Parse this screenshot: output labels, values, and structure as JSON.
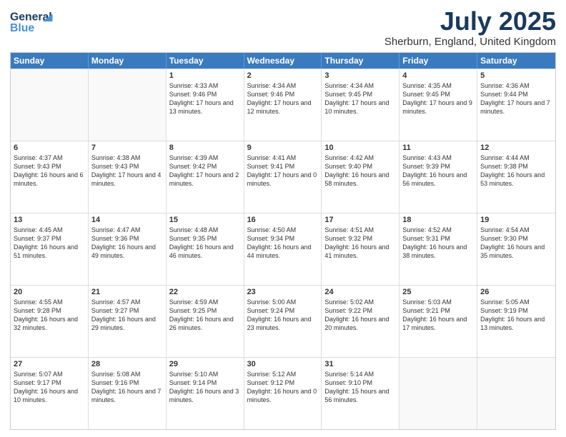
{
  "logo": {
    "line1": "General",
    "line2": "Blue"
  },
  "header": {
    "month": "July 2025",
    "location": "Sherburn, England, United Kingdom"
  },
  "days_of_week": [
    "Sunday",
    "Monday",
    "Tuesday",
    "Wednesday",
    "Thursday",
    "Friday",
    "Saturday"
  ],
  "weeks": [
    [
      {
        "day": "",
        "empty": true
      },
      {
        "day": "",
        "empty": true
      },
      {
        "day": "1",
        "sunrise": "4:33 AM",
        "sunset": "9:46 PM",
        "daylight": "17 hours and 13 minutes."
      },
      {
        "day": "2",
        "sunrise": "4:34 AM",
        "sunset": "9:46 PM",
        "daylight": "17 hours and 12 minutes."
      },
      {
        "day": "3",
        "sunrise": "4:34 AM",
        "sunset": "9:45 PM",
        "daylight": "17 hours and 10 minutes."
      },
      {
        "day": "4",
        "sunrise": "4:35 AM",
        "sunset": "9:45 PM",
        "daylight": "17 hours and 9 minutes."
      },
      {
        "day": "5",
        "sunrise": "4:36 AM",
        "sunset": "9:44 PM",
        "daylight": "17 hours and 7 minutes."
      }
    ],
    [
      {
        "day": "6",
        "sunrise": "4:37 AM",
        "sunset": "9:43 PM",
        "daylight": "16 hours and 6 minutes."
      },
      {
        "day": "7",
        "sunrise": "4:38 AM",
        "sunset": "9:43 PM",
        "daylight": "17 hours and 4 minutes."
      },
      {
        "day": "8",
        "sunrise": "4:39 AM",
        "sunset": "9:42 PM",
        "daylight": "17 hours and 2 minutes."
      },
      {
        "day": "9",
        "sunrise": "4:41 AM",
        "sunset": "9:41 PM",
        "daylight": "17 hours and 0 minutes."
      },
      {
        "day": "10",
        "sunrise": "4:42 AM",
        "sunset": "9:40 PM",
        "daylight": "16 hours and 58 minutes."
      },
      {
        "day": "11",
        "sunrise": "4:43 AM",
        "sunset": "9:39 PM",
        "daylight": "16 hours and 56 minutes."
      },
      {
        "day": "12",
        "sunrise": "4:44 AM",
        "sunset": "9:38 PM",
        "daylight": "16 hours and 53 minutes."
      }
    ],
    [
      {
        "day": "13",
        "sunrise": "4:45 AM",
        "sunset": "9:37 PM",
        "daylight": "16 hours and 51 minutes."
      },
      {
        "day": "14",
        "sunrise": "4:47 AM",
        "sunset": "9:36 PM",
        "daylight": "16 hours and 49 minutes."
      },
      {
        "day": "15",
        "sunrise": "4:48 AM",
        "sunset": "9:35 PM",
        "daylight": "16 hours and 46 minutes."
      },
      {
        "day": "16",
        "sunrise": "4:50 AM",
        "sunset": "9:34 PM",
        "daylight": "16 hours and 44 minutes."
      },
      {
        "day": "17",
        "sunrise": "4:51 AM",
        "sunset": "9:32 PM",
        "daylight": "16 hours and 41 minutes."
      },
      {
        "day": "18",
        "sunrise": "4:52 AM",
        "sunset": "9:31 PM",
        "daylight": "16 hours and 38 minutes."
      },
      {
        "day": "19",
        "sunrise": "4:54 AM",
        "sunset": "9:30 PM",
        "daylight": "16 hours and 35 minutes."
      }
    ],
    [
      {
        "day": "20",
        "sunrise": "4:55 AM",
        "sunset": "9:28 PM",
        "daylight": "16 hours and 32 minutes."
      },
      {
        "day": "21",
        "sunrise": "4:57 AM",
        "sunset": "9:27 PM",
        "daylight": "16 hours and 29 minutes."
      },
      {
        "day": "22",
        "sunrise": "4:59 AM",
        "sunset": "9:25 PM",
        "daylight": "16 hours and 26 minutes."
      },
      {
        "day": "23",
        "sunrise": "5:00 AM",
        "sunset": "9:24 PM",
        "daylight": "16 hours and 23 minutes."
      },
      {
        "day": "24",
        "sunrise": "5:02 AM",
        "sunset": "9:22 PM",
        "daylight": "16 hours and 20 minutes."
      },
      {
        "day": "25",
        "sunrise": "5:03 AM",
        "sunset": "9:21 PM",
        "daylight": "16 hours and 17 minutes."
      },
      {
        "day": "26",
        "sunrise": "5:05 AM",
        "sunset": "9:19 PM",
        "daylight": "16 hours and 13 minutes."
      }
    ],
    [
      {
        "day": "27",
        "sunrise": "5:07 AM",
        "sunset": "9:17 PM",
        "daylight": "16 hours and 10 minutes."
      },
      {
        "day": "28",
        "sunrise": "5:08 AM",
        "sunset": "9:16 PM",
        "daylight": "16 hours and 7 minutes."
      },
      {
        "day": "29",
        "sunrise": "5:10 AM",
        "sunset": "9:14 PM",
        "daylight": "16 hours and 3 minutes."
      },
      {
        "day": "30",
        "sunrise": "5:12 AM",
        "sunset": "9:12 PM",
        "daylight": "16 hours and 0 minutes."
      },
      {
        "day": "31",
        "sunrise": "5:14 AM",
        "sunset": "9:10 PM",
        "daylight": "15 hours and 56 minutes."
      },
      {
        "day": "",
        "empty": true
      },
      {
        "day": "",
        "empty": true
      }
    ]
  ]
}
